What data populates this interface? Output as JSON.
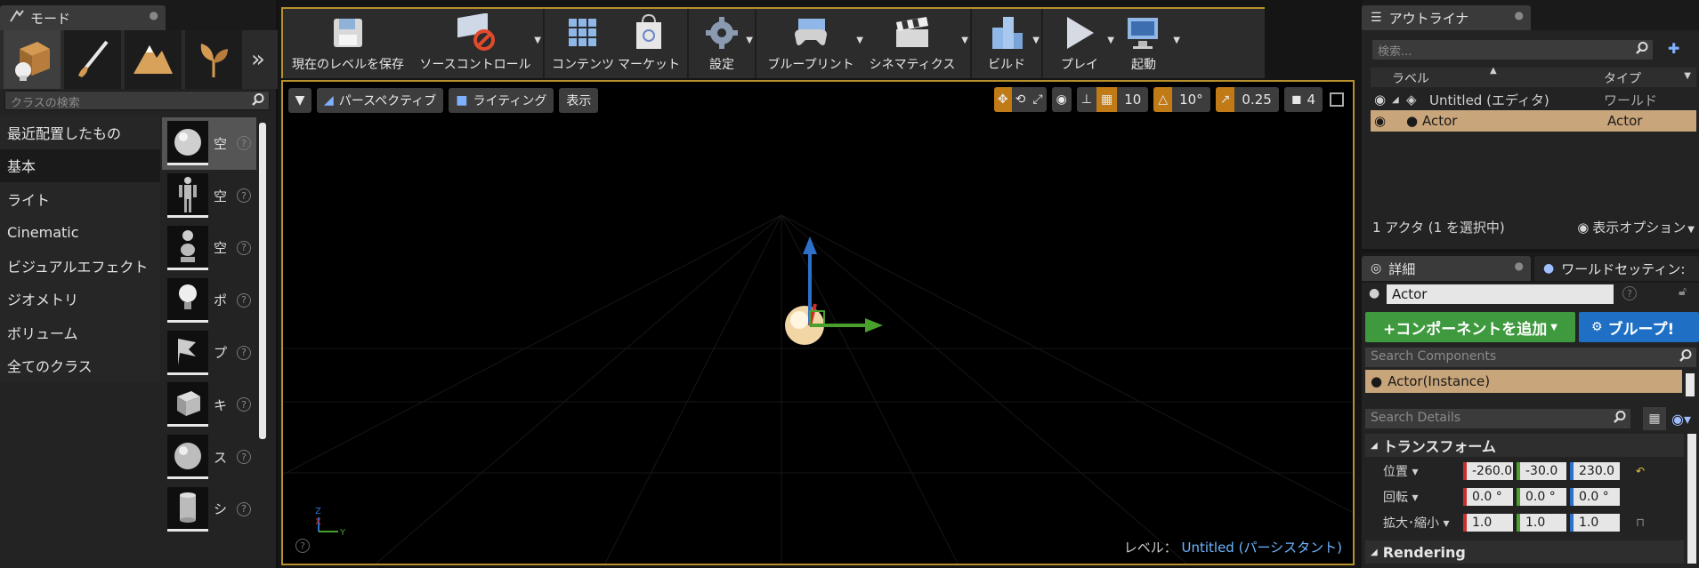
{
  "modes": {
    "tab_title": "モード",
    "search_placeholder": "クラスの検索",
    "categories": [
      {
        "label": "最近配置したもの"
      },
      {
        "label": "基本"
      },
      {
        "label": "ライト"
      },
      {
        "label": "Cinematic"
      },
      {
        "label": "ビジュアルエフェクト"
      },
      {
        "label": "ジオメトリ"
      },
      {
        "label": "ボリューム"
      },
      {
        "label": "全てのクラス"
      }
    ],
    "assets": [
      {
        "label": "空"
      },
      {
        "label": "空"
      },
      {
        "label": "空"
      },
      {
        "label": "ポ"
      },
      {
        "label": "プ"
      },
      {
        "label": "キ"
      },
      {
        "label": "ス"
      },
      {
        "label": "シ"
      }
    ],
    "help_glyph": "?"
  },
  "toolbar": {
    "items": [
      {
        "label": "現在のレベルを保存"
      },
      {
        "label": "ソースコントロール"
      },
      {
        "label": "コンテンツ"
      },
      {
        "label": "マーケット"
      },
      {
        "label": "設定"
      },
      {
        "label": "ブループリント"
      },
      {
        "label": "シネマティクス"
      },
      {
        "label": "ビルド"
      },
      {
        "label": "プレイ"
      },
      {
        "label": "起動"
      }
    ]
  },
  "viewport": {
    "perspective_label": "パースペクティブ",
    "lighting_label": "ライティング",
    "show_label": "表示",
    "grid_snap": "10",
    "rotation_snap": "10°",
    "scale_snap": "0.25",
    "camera_speed": "4",
    "level_prefix": "レベル：",
    "level_name": "Untitled (パーシスタント)"
  },
  "outliner": {
    "tab_title": "アウトライナ",
    "search_placeholder": "検索...",
    "col_label": "ラベル",
    "col_type": "タイプ",
    "rows": [
      {
        "label": "Untitled (エディタ)",
        "type": "ワールド"
      },
      {
        "label": "Actor",
        "type": "Actor"
      }
    ],
    "footer_count": "1 アクタ (1 を選択中)",
    "footer_options": "表示オプション"
  },
  "details": {
    "tab_details": "詳細",
    "tab_world": "ワールドセッティン:",
    "actor_name": "Actor",
    "add_component": "+コンポーネントを追加",
    "blueprint_btn": "ブループ!",
    "search_components": "Search Components",
    "component_instance": "Actor(Instance)",
    "search_details": "Search Details",
    "section_transform": "トランスフォーム",
    "location_label": "位置",
    "rotation_label": "回転",
    "scale_label": "拡大･縮小",
    "location": [
      "-260.0",
      "-30.0",
      "230.0"
    ],
    "rotation": [
      "0.0 °",
      "0.0 °",
      "0.0 °"
    ],
    "scale": [
      "1.0",
      "1.0",
      "1.0"
    ],
    "section_rendering": "Rendering"
  },
  "colors": {
    "accent_gold": "#b8912c",
    "selection": "#c8a57a",
    "add_green": "#3f9a3f",
    "blueprint_blue": "#1f70c4",
    "axis_x": "#c9302c",
    "axis_y": "#4aa02c",
    "axis_z": "#2d6fc9"
  }
}
